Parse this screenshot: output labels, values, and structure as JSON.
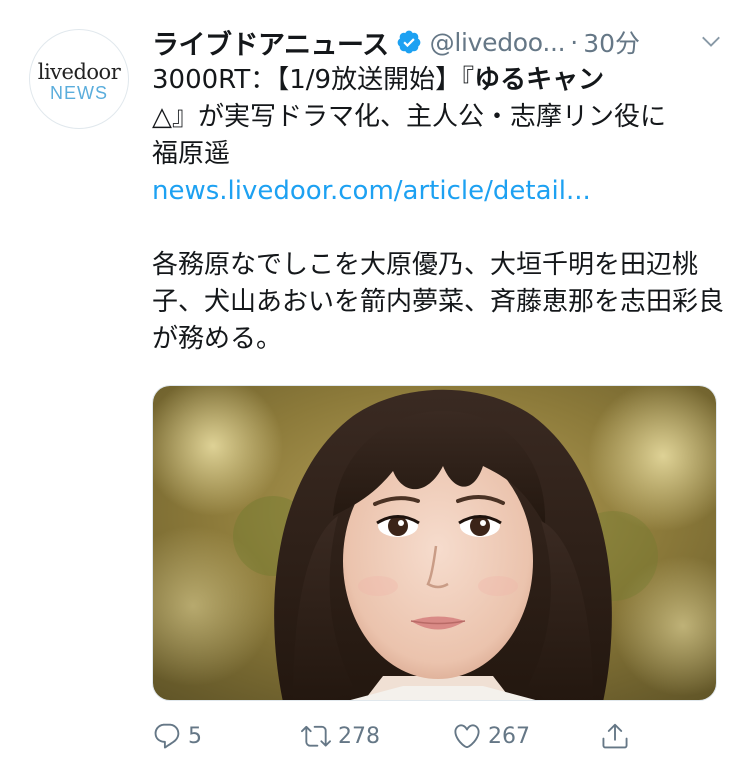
{
  "account": {
    "avatar_brand": "livedoor",
    "avatar_sub": "NEWS",
    "display_name": "ライブドアニュース",
    "handle": "@livedoo...",
    "separator": "·",
    "time": "30分"
  },
  "tweet": {
    "line1_prefix": "3000RT：【1/9放送開始】『",
    "line1_bold": "ゆるキャン",
    "line2": "△』が実写ドラマ化、主人公・志摩リン役に",
    "line3": "福原遥",
    "link": "news.livedoor.com/article/detail...",
    "para2": "各務原なでしこを大原優乃、大垣千明を田辺桃子、犬山あおいを箭内夢菜、斉藤恵那を志田彩良が務める。"
  },
  "actions": {
    "replies": "5",
    "retweets": "278",
    "likes": "267"
  },
  "colors": {
    "accent": "#1da1f2",
    "muted": "#657786",
    "text": "#14171a"
  },
  "icons": [
    "verified-badge-icon",
    "chevron-down-icon",
    "reply-icon",
    "retweet-icon",
    "like-icon",
    "share-icon"
  ]
}
